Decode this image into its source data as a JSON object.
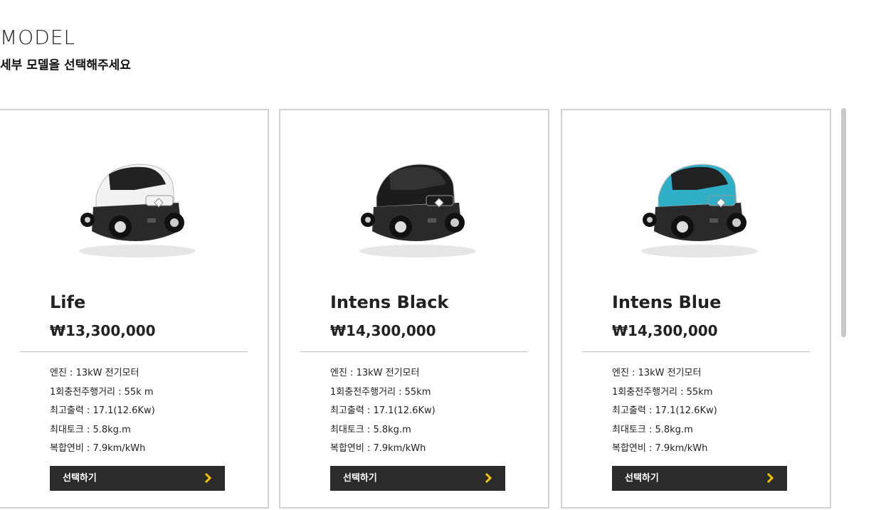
{
  "header": {
    "title": "MODEL",
    "subtitle": "세부 모델을 선택해주세요"
  },
  "accent_color": "#f5c400",
  "button_color": "#2b2b2b",
  "models": [
    {
      "name": "Life",
      "price": "₩13,300,000",
      "body_color": "#f2f2f2",
      "specs": [
        "엔진 : 13kW 전기모터",
        "1회충전주행거리 : 55k m",
        "최고출력 : 17.1(12.6Kw)",
        "최대토크 : 5.8kg.m",
        "복합연비 : 7.9km/kWh"
      ],
      "button_label": "선택하기",
      "button_icon": "chevron-right-icon"
    },
    {
      "name": "Intens Black",
      "price": "₩14,300,000",
      "body_color": "#1c1c1c",
      "specs": [
        "엔진 : 13kW 전기모터",
        "1회충전주행거리 : 55km",
        "최고출력 : 17.1(12.6Kw)",
        "최대토크 : 5.8kg.m",
        "복합연비 : 7.9km/kWh"
      ],
      "button_label": "선택하기",
      "button_icon": "chevron-right-icon"
    },
    {
      "name": "Intens Blue",
      "price": "₩14,300,000",
      "body_color": "#2fb0c8",
      "specs": [
        "엔진 : 13kW 전기모터",
        "1회충전주행거리 : 55km",
        "최고출력 : 17.1(12.6Kw)",
        "최대토크 : 5.8kg.m",
        "복합연비 : 7.9km/kWh"
      ],
      "button_label": "선택하기",
      "button_icon": "chevron-right-icon"
    }
  ]
}
